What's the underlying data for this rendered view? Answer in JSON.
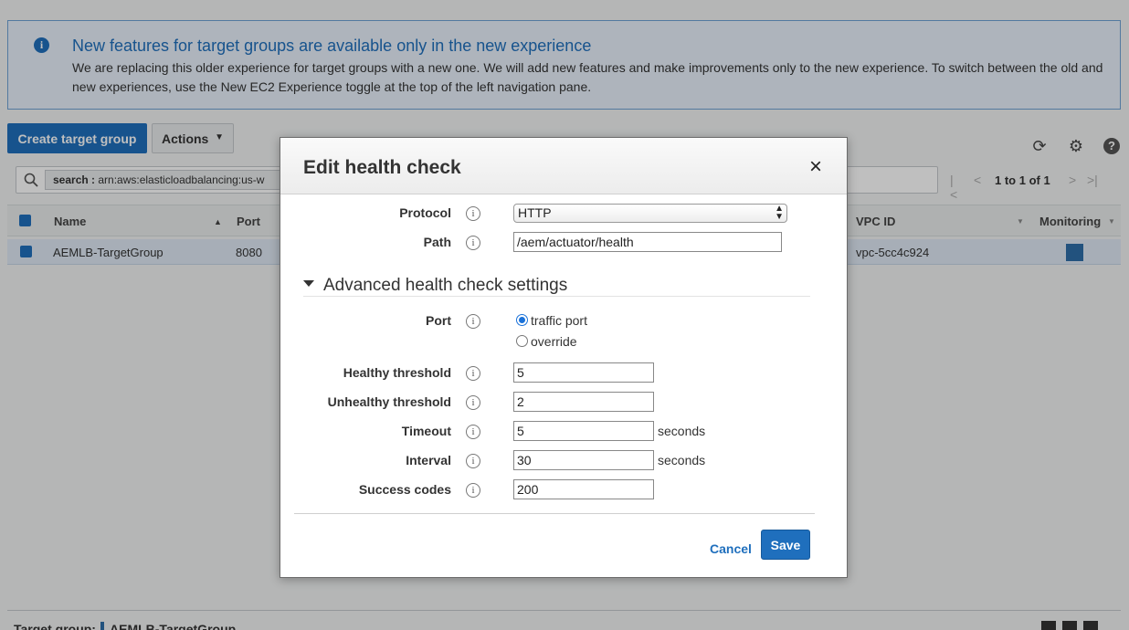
{
  "banner": {
    "title": "New features for target groups are available only in the new experience",
    "text": "We are replacing this older experience for target groups with a new one. We will add new features and make improvements only to the new experience. To switch between the old and new experiences, use the New EC2 Experience toggle at the top of the left navigation pane.",
    "icon": "info-icon"
  },
  "toolbar": {
    "create_label": "Create target group",
    "actions_label": "Actions"
  },
  "search": {
    "key": "search : ",
    "value": "arn:aws:elasticloadbalancing:us-w"
  },
  "pager": {
    "text": "1 to 1 of 1"
  },
  "table": {
    "columns": [
      "Name",
      "Port",
      "VPC ID",
      "Monitoring"
    ],
    "rows": [
      {
        "name": "AEMLB-TargetGroup",
        "port": "8080",
        "vpc": "vpc-5cc4c924"
      }
    ]
  },
  "bottom_panel": {
    "label": "Target group:",
    "name": "AEMLB-TargetGroup"
  },
  "modal": {
    "title": "Edit health check",
    "close": "×",
    "protocol_label": "Protocol",
    "protocol_value": "HTTP",
    "path_label": "Path",
    "path_value": "/aem/actuator/health",
    "advanced_title": "Advanced health check settings",
    "port_label": "Port",
    "port_options": [
      "traffic port",
      "override"
    ],
    "port_selected": "traffic port",
    "healthy_label": "Healthy threshold",
    "healthy_value": "5",
    "unhealthy_label": "Unhealthy threshold",
    "unhealthy_value": "2",
    "timeout_label": "Timeout",
    "timeout_value": "5",
    "interval_label": "Interval",
    "interval_value": "30",
    "seconds": "seconds",
    "success_label": "Success codes",
    "success_value": "200",
    "cancel_label": "Cancel",
    "save_label": "Save",
    "info_glyph": "i"
  },
  "colors": {
    "primary": "#1f6fbd",
    "banner_bg": "#e8f1fb",
    "selected_row": "#dfe9f5"
  }
}
